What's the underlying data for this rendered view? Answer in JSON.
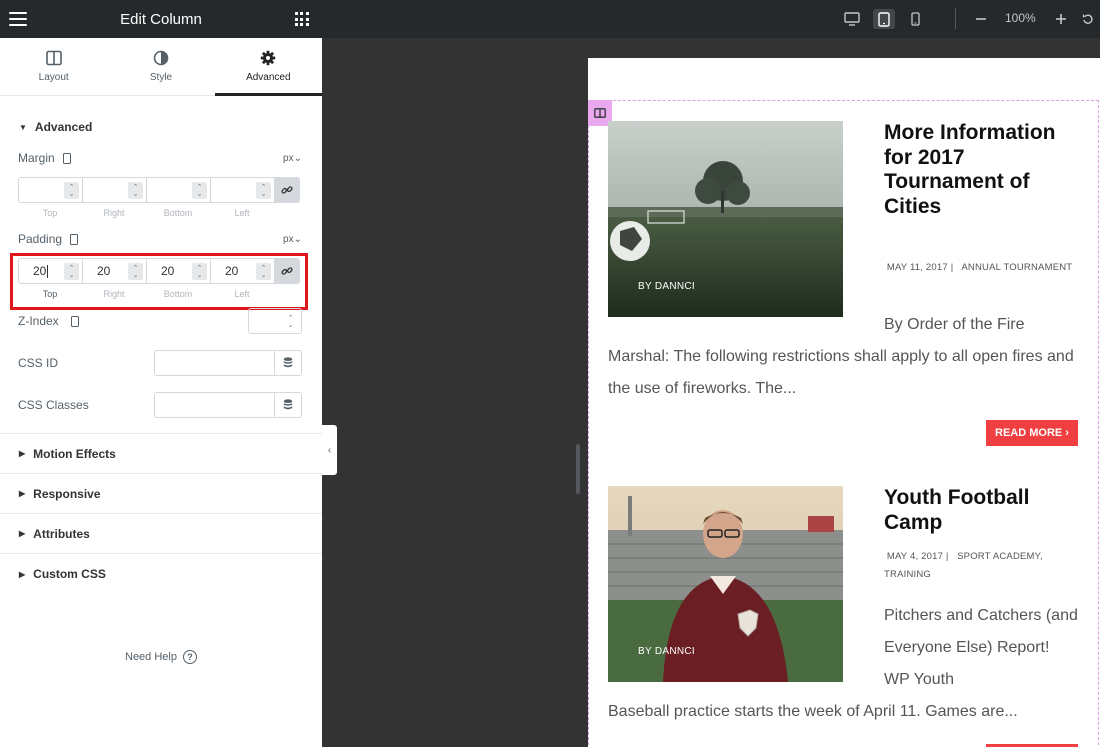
{
  "panel": {
    "title": "Edit Column",
    "tabs": [
      {
        "label": "Layout",
        "icon": "columns-icon"
      },
      {
        "label": "Style",
        "icon": "half-circle-icon"
      },
      {
        "label": "Advanced",
        "icon": "gear-icon",
        "active": true
      }
    ],
    "advanced": {
      "title": "Advanced",
      "margin": {
        "label": "Margin",
        "unit": "px",
        "values": [
          "",
          "",
          "",
          ""
        ],
        "side_labels": [
          "Top",
          "Right",
          "Bottom",
          "Left"
        ]
      },
      "padding": {
        "label": "Padding",
        "unit": "px",
        "values": [
          "20",
          "20",
          "20",
          "20"
        ],
        "side_labels": [
          "Top",
          "Right",
          "Bottom",
          "Left"
        ]
      },
      "z_index": {
        "label": "Z-Index",
        "value": ""
      },
      "css_id": {
        "label": "CSS ID",
        "value": ""
      },
      "css_classes": {
        "label": "CSS Classes",
        "value": ""
      }
    },
    "sections": [
      "Motion Effects",
      "Responsive",
      "Attributes",
      "Custom CSS"
    ],
    "need_help": "Need Help",
    "help_glyph": "?"
  },
  "toolbar": {
    "zoom": "100%",
    "active_device": "tablet"
  },
  "preview": {
    "posts": [
      {
        "title": "More Information for 2017 Tournament of Cities",
        "date": "MAY 11, 2017",
        "categories": "ANNUAL TOURNAMENT",
        "author": "BY DANNCI",
        "excerpt_first": "By Order of the Fire",
        "excerpt_rest": "Marshal: The following restrictions shall apply to all open fires and the use of fireworks. The...",
        "read_more": "READ MORE ›"
      },
      {
        "title": "Youth Football Camp",
        "date": "MAY 4, 2017",
        "categories": "SPORT ACADEMY, TRAINING",
        "author": "BY DANNCI",
        "excerpt_first": "Pitchers and Catchers (and Everyone Else) Report! WP Youth",
        "excerpt_rest": "Baseball practice starts the week of April 11. Games are..."
      }
    ]
  },
  "colors": {
    "panel_header_bg": "#26292c",
    "canvas_bg": "#333333",
    "highlight": "#e0161d",
    "read_more_bg": "#ef3f41",
    "column_outline": "#e8a9ef"
  }
}
